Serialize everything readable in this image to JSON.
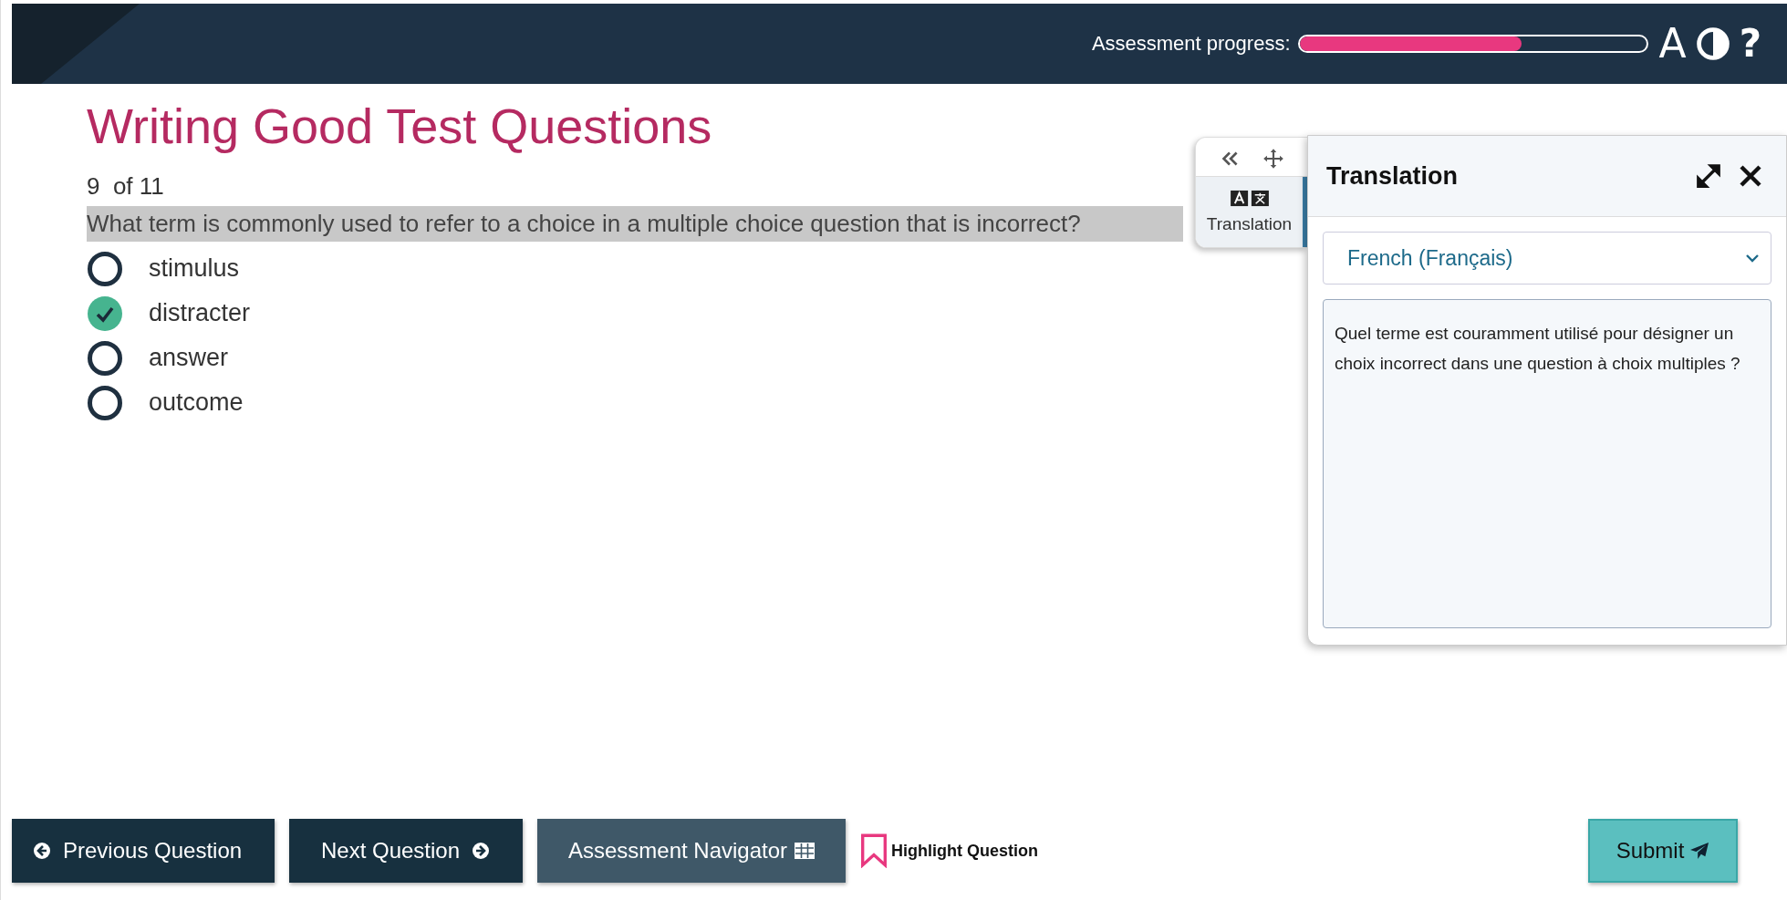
{
  "header": {
    "progress_label": "Assessment progress:",
    "progress": {
      "level": 0.64
    },
    "text_size_button": "A",
    "help_button": "?"
  },
  "assessment_title": "Writing Good Test Questions",
  "question": {
    "counter": "9  of 11",
    "text": "What term is commonly used to refer to a choice in a multiple choice question that is incorrect?",
    "highlighted": true,
    "options": [
      {
        "label": "stimulus",
        "selected": false
      },
      {
        "label": "distracter",
        "selected": true
      },
      {
        "label": "answer",
        "selected": false
      },
      {
        "label": "outcome",
        "selected": false
      }
    ]
  },
  "translation_panel": {
    "tab_label": "Translation",
    "title": "Translation",
    "language": "French (Français)",
    "translated_text": "Quel terme est couramment utilisé pour désigner un choix incorrect dans une question à choix multiples ?"
  },
  "footer_buttons": [
    {
      "kind": "previous",
      "label": "Previous Question"
    },
    {
      "kind": "next",
      "label": "Next Question"
    },
    {
      "kind": "navigator",
      "label": "Assessment Navigator"
    },
    {
      "kind": "highlight",
      "label": "Highlight Question"
    },
    {
      "kind": "submit",
      "label": "Submit"
    }
  ]
}
